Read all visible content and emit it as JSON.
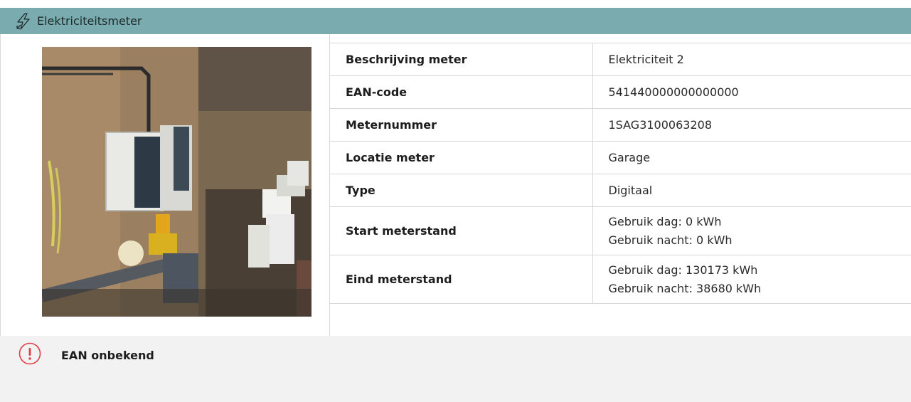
{
  "header": {
    "title": "Elektriciteitsmeter",
    "icon": "lightning-bolt-icon"
  },
  "photo": {
    "description_icon": "meter-photo"
  },
  "meter_table": {
    "rows": [
      {
        "label": "Beschrijving meter",
        "value": "Elektriciteit 2"
      },
      {
        "label": "EAN-code",
        "value": "541440000000000000"
      },
      {
        "label": "Meternummer",
        "value": "1SAG3100063208"
      },
      {
        "label": "Locatie meter",
        "value": "Garage"
      },
      {
        "label": "Type",
        "value": "Digitaal"
      },
      {
        "label": "Start meterstand",
        "value_lines": [
          "Gebruik dag: 0 kWh",
          "Gebruik nacht: 0 kWh"
        ]
      },
      {
        "label": "Eind meterstand",
        "value_lines": [
          "Gebruik dag: 130173 kWh",
          "Gebruik nacht: 38680 kWh"
        ]
      }
    ]
  },
  "notice": {
    "icon": "exclamation-circle-icon",
    "message": "EAN onbekend"
  },
  "colors": {
    "header_bg": "#7aabae",
    "notice_bg": "#f1f2f1",
    "warning": "#e0404a",
    "border": "#d7d7d7"
  }
}
